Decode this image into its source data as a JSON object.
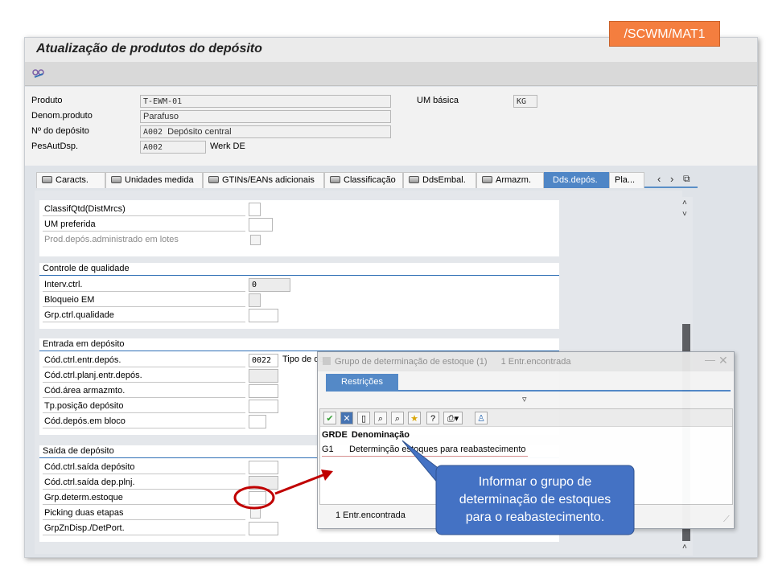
{
  "overlay_tag": "/SCWM/MAT1",
  "window": {
    "title": "Atualização de produtos do depósito",
    "toolbar_icon": "glasses-icon"
  },
  "header": {
    "produto_label": "Produto",
    "produto_value": "T-EWM-01",
    "um_basica_label": "UM básica",
    "um_basica_value": "KG",
    "denom_label": "Denom.produto",
    "denom_value": "Parafuso",
    "deposito_label": "Nº do depósito",
    "deposito_value": "A002",
    "deposito_desc": "Depósito central",
    "pesaut_label": "PesAutDsp.",
    "pesaut_value": "A002",
    "pesaut_desc": "Werk DE"
  },
  "tabs": [
    {
      "label": "Caracts."
    },
    {
      "label": "Unidades medida"
    },
    {
      "label": "GTINs/EANs adicionais"
    },
    {
      "label": "Classificação"
    },
    {
      "label": "DdsEmbal."
    },
    {
      "label": "Armazm."
    },
    {
      "label": "Dds.depós."
    },
    {
      "label": "Pla..."
    }
  ],
  "groups": {
    "top": {
      "rows": [
        {
          "label": "ClassifQtd(DistMrcs)"
        },
        {
          "label": "UM preferida"
        },
        {
          "label": "Prod.depós.administrado em lotes"
        }
      ]
    },
    "qualidade": {
      "title": "Controle de qualidade",
      "rows": [
        {
          "label": "Interv.ctrl.",
          "value": "0"
        },
        {
          "label": "Bloqueio EM"
        },
        {
          "label": "Grp.ctrl.qualidade"
        }
      ]
    },
    "entrada": {
      "title": "Entrada em depósito",
      "rows": [
        {
          "label": "Cód.ctrl.entr.depós.",
          "value": "0022",
          "extra": "Tipo de de"
        },
        {
          "label": "Cód.ctrl.planj.entr.depós."
        },
        {
          "label": "Cód.área armazmto."
        },
        {
          "label": "Tp.posição depósito"
        },
        {
          "label": "Cód.depós.em bloco"
        }
      ]
    },
    "saida": {
      "title": "Saída de depósito",
      "rows": [
        {
          "label": "Cód.ctrl.saída depósito"
        },
        {
          "label": "Cód.ctrl.saída dep.plnj."
        },
        {
          "label": "Grp.determ.estoque"
        },
        {
          "label": "Picking duas etapas"
        },
        {
          "label": "GrpZnDisp./DetPort."
        }
      ]
    }
  },
  "dialog": {
    "title": "Grupo de determinação de estoque (1)",
    "title_count": "1 Entr.encontrada",
    "tab": "Restrições",
    "col_key": "GRDE",
    "col_desc": "Denominação",
    "rows": [
      {
        "key": "G1",
        "desc": "Determinção estoques para reabastecimento"
      }
    ],
    "status": "1 Entr.encontrada"
  },
  "callout": {
    "line1": "Informar o grupo de",
    "line2": "determinação de estoques",
    "line3": "para o reabastecimento.",
    "fill_color": "#4472c4",
    "arrow_color": "#c00000"
  }
}
